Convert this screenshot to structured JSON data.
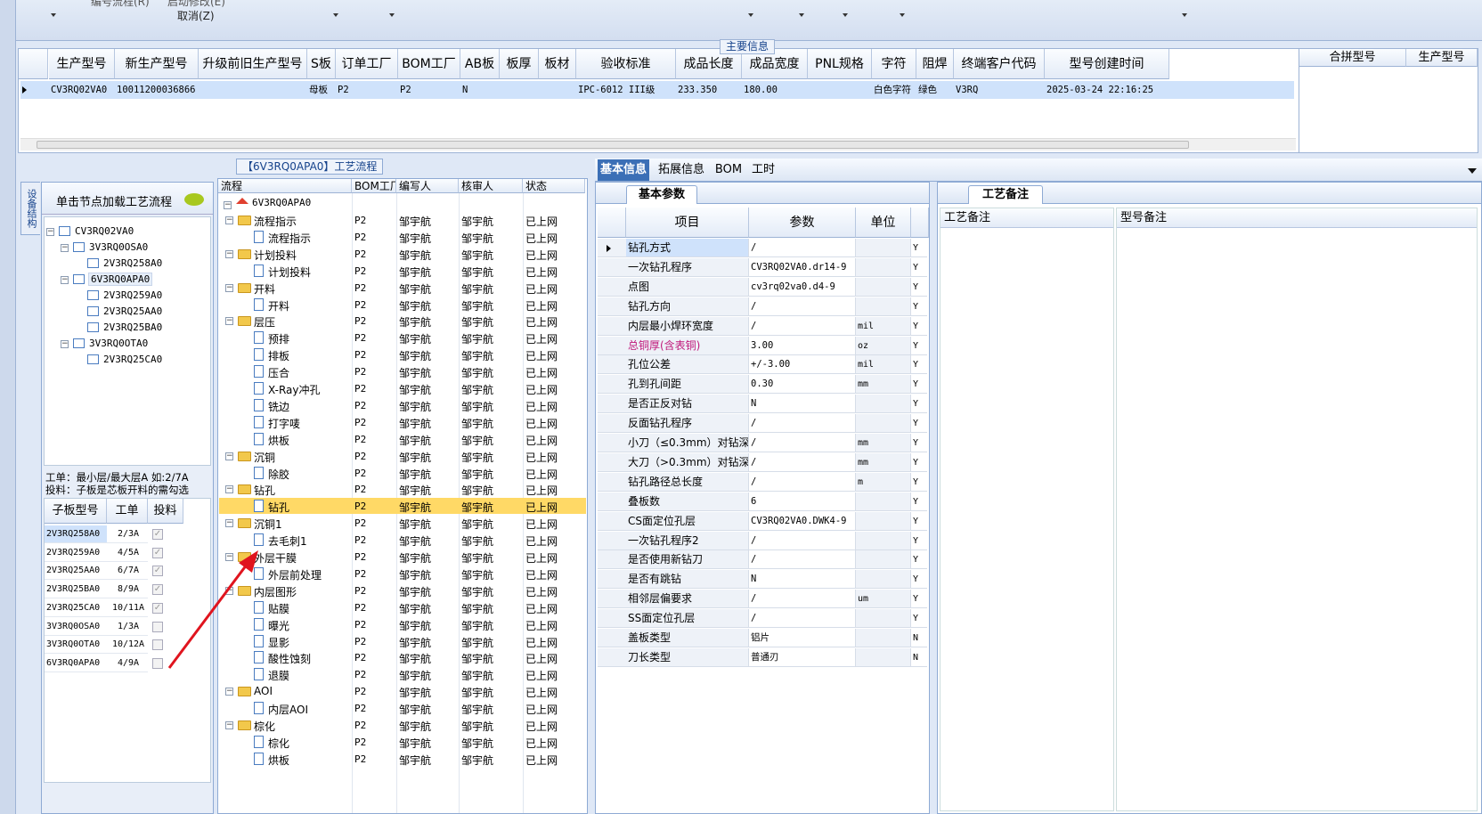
{
  "toolbar": {
    "item1": "编号流程(R)",
    "item2": "启动修改(E)",
    "cancel": "取消(Z)"
  },
  "main_info": {
    "caption": "主要信息",
    "columns": [
      "生产型号",
      "新生产型号",
      "升级前旧生产型号",
      "S板",
      "订单工厂",
      "BOM工厂",
      "AB板",
      "板厚",
      "板材",
      "验收标准",
      "成品长度",
      "成品宽度",
      "PNL规格",
      "字符",
      "阻焊",
      "终端客户代码",
      "型号创建时间"
    ],
    "row": [
      "CV3RQ02VA0",
      "10011200036866",
      "",
      "母板",
      "P2",
      "P2",
      "N",
      "",
      "",
      "IPC-6012 III级",
      "233.350",
      "180.00",
      "",
      "白色字符",
      "绿色",
      "V3RQ",
      "2025-03-24 22:16:25"
    ],
    "side_columns": [
      "合拼型号",
      "生产型号"
    ]
  },
  "process_panel": {
    "caption": "【6V3RQ0APA0】工艺流程",
    "columns": [
      "流程",
      "BOM工厂",
      "编写人",
      "核审人",
      "状态"
    ],
    "root": "6V3RQ0APA0",
    "rows": [
      {
        "level": 1,
        "name": "流程指示",
        "folder": true,
        "bom": "P2",
        "writer": "邹宇航",
        "reviewer": "邹宇航",
        "status": "已上网"
      },
      {
        "level": 2,
        "name": "流程指示",
        "folder": false,
        "bom": "P2",
        "writer": "邹宇航",
        "reviewer": "邹宇航",
        "status": "已上网"
      },
      {
        "level": 1,
        "name": "计划投料",
        "folder": true,
        "bom": "P2",
        "writer": "邹宇航",
        "reviewer": "邹宇航",
        "status": "已上网"
      },
      {
        "level": 2,
        "name": "计划投料",
        "folder": false,
        "bom": "P2",
        "writer": "邹宇航",
        "reviewer": "邹宇航",
        "status": "已上网"
      },
      {
        "level": 1,
        "name": "开料",
        "folder": true,
        "bom": "P2",
        "writer": "邹宇航",
        "reviewer": "邹宇航",
        "status": "已上网"
      },
      {
        "level": 2,
        "name": "开料",
        "folder": false,
        "bom": "P2",
        "writer": "邹宇航",
        "reviewer": "邹宇航",
        "status": "已上网"
      },
      {
        "level": 1,
        "name": "层压",
        "folder": true,
        "bom": "P2",
        "writer": "邹宇航",
        "reviewer": "邹宇航",
        "status": "已上网"
      },
      {
        "level": 2,
        "name": "预排",
        "folder": false,
        "bom": "P2",
        "writer": "邹宇航",
        "reviewer": "邹宇航",
        "status": "已上网"
      },
      {
        "level": 2,
        "name": "排板",
        "folder": false,
        "bom": "P2",
        "writer": "邹宇航",
        "reviewer": "邹宇航",
        "status": "已上网"
      },
      {
        "level": 2,
        "name": "压合",
        "folder": false,
        "bom": "P2",
        "writer": "邹宇航",
        "reviewer": "邹宇航",
        "status": "已上网"
      },
      {
        "level": 2,
        "name": "X-Ray冲孔",
        "folder": false,
        "bom": "P2",
        "writer": "邹宇航",
        "reviewer": "邹宇航",
        "status": "已上网"
      },
      {
        "level": 2,
        "name": "铣边",
        "folder": false,
        "bom": "P2",
        "writer": "邹宇航",
        "reviewer": "邹宇航",
        "status": "已上网"
      },
      {
        "level": 2,
        "name": "打字唛",
        "folder": false,
        "bom": "P2",
        "writer": "邹宇航",
        "reviewer": "邹宇航",
        "status": "已上网"
      },
      {
        "level": 2,
        "name": "烘板",
        "folder": false,
        "bom": "P2",
        "writer": "邹宇航",
        "reviewer": "邹宇航",
        "status": "已上网"
      },
      {
        "level": 1,
        "name": "沉铜",
        "folder": true,
        "bom": "P2",
        "writer": "邹宇航",
        "reviewer": "邹宇航",
        "status": "已上网"
      },
      {
        "level": 2,
        "name": "除胶",
        "folder": false,
        "bom": "P2",
        "writer": "邹宇航",
        "reviewer": "邹宇航",
        "status": "已上网"
      },
      {
        "level": 1,
        "name": "钻孔",
        "folder": true,
        "bom": "P2",
        "writer": "邹宇航",
        "reviewer": "邹宇航",
        "status": "已上网"
      },
      {
        "level": 2,
        "name": "钻孔",
        "folder": false,
        "bom": "P2",
        "writer": "邹宇航",
        "reviewer": "邹宇航",
        "status": "已上网",
        "selected": true
      },
      {
        "level": 1,
        "name": "沉铜1",
        "folder": true,
        "bom": "P2",
        "writer": "邹宇航",
        "reviewer": "邹宇航",
        "status": "已上网"
      },
      {
        "level": 2,
        "name": "去毛刺1",
        "folder": false,
        "bom": "P2",
        "writer": "邹宇航",
        "reviewer": "邹宇航",
        "status": "已上网"
      },
      {
        "level": 1,
        "name": "外层干膜",
        "folder": true,
        "bom": "P2",
        "writer": "邹宇航",
        "reviewer": "邹宇航",
        "status": "已上网"
      },
      {
        "level": 2,
        "name": "外层前处理",
        "folder": false,
        "bom": "P2",
        "writer": "邹宇航",
        "reviewer": "邹宇航",
        "status": "已上网"
      },
      {
        "level": 1,
        "name": "内层图形",
        "folder": true,
        "bom": "P2",
        "writer": "邹宇航",
        "reviewer": "邹宇航",
        "status": "已上网"
      },
      {
        "level": 2,
        "name": "贴膜",
        "folder": false,
        "bom": "P2",
        "writer": "邹宇航",
        "reviewer": "邹宇航",
        "status": "已上网"
      },
      {
        "level": 2,
        "name": "曝光",
        "folder": false,
        "bom": "P2",
        "writer": "邹宇航",
        "reviewer": "邹宇航",
        "status": "已上网"
      },
      {
        "level": 2,
        "name": "显影",
        "folder": false,
        "bom": "P2",
        "writer": "邹宇航",
        "reviewer": "邹宇航",
        "status": "已上网"
      },
      {
        "level": 2,
        "name": "酸性蚀刻",
        "folder": false,
        "bom": "P2",
        "writer": "邹宇航",
        "reviewer": "邹宇航",
        "status": "已上网"
      },
      {
        "level": 2,
        "name": "退膜",
        "folder": false,
        "bom": "P2",
        "writer": "邹宇航",
        "reviewer": "邹宇航",
        "status": "已上网"
      },
      {
        "level": 1,
        "name": "AOI",
        "folder": true,
        "bom": "P2",
        "writer": "邹宇航",
        "reviewer": "邹宇航",
        "status": "已上网"
      },
      {
        "level": 2,
        "name": "内层AOI",
        "folder": false,
        "bom": "P2",
        "writer": "邹宇航",
        "reviewer": "邹宇航",
        "status": "已上网"
      },
      {
        "level": 1,
        "name": "棕化",
        "folder": true,
        "bom": "P2",
        "writer": "邹宇航",
        "reviewer": "邹宇航",
        "status": "已上网"
      },
      {
        "level": 2,
        "name": "棕化",
        "folder": false,
        "bom": "P2",
        "writer": "邹宇航",
        "reviewer": "邹宇航",
        "status": "已上网"
      },
      {
        "level": 2,
        "name": "烘板",
        "folder": false,
        "bom": "P2",
        "writer": "邹宇航",
        "reviewer": "邹宇航",
        "status": "已上网"
      }
    ]
  },
  "left_panel": {
    "side_tab": "设备结构",
    "hint": "单击节点加载工艺流程",
    "tree": [
      {
        "level": 0,
        "name": "CV3RQ02VA0"
      },
      {
        "level": 1,
        "name": "3V3RQ0OSA0"
      },
      {
        "level": 2,
        "name": "2V3RQ258A0"
      },
      {
        "level": 1,
        "name": "6V3RQ0APA0",
        "selected": true
      },
      {
        "level": 2,
        "name": "2V3RQ259A0"
      },
      {
        "level": 2,
        "name": "2V3RQ25AA0"
      },
      {
        "level": 2,
        "name": "2V3RQ25BA0"
      },
      {
        "level": 1,
        "name": "3V3RQ0OTA0"
      },
      {
        "level": 2,
        "name": "2V3RQ25CA0"
      }
    ],
    "note1": "工单：最小层/最大层A 如:2/7A",
    "note2": "投料：子板是芯板开料的需勾选",
    "sub_columns": [
      "子板型号",
      "工单",
      "投料"
    ],
    "sub_rows": [
      {
        "model": "2V3RQ258A0",
        "order": "2/3A",
        "feed": true
      },
      {
        "model": "2V3RQ259A0",
        "order": "4/5A",
        "feed": true
      },
      {
        "model": "2V3RQ25AA0",
        "order": "6/7A",
        "feed": true
      },
      {
        "model": "2V3RQ25BA0",
        "order": "8/9A",
        "feed": true
      },
      {
        "model": "2V3RQ25CA0",
        "order": "10/11A",
        "feed": true
      },
      {
        "model": "3V3RQ0OSA0",
        "order": "1/3A",
        "feed": false
      },
      {
        "model": "3V3RQ0OTA0",
        "order": "10/12A",
        "feed": false
      },
      {
        "model": "6V3RQ0APA0",
        "order": "4/9A",
        "feed": false
      }
    ]
  },
  "right_panel": {
    "tabs": [
      "基本信息",
      "拓展信息",
      "BOM",
      "工时"
    ],
    "subtab": "基本参数",
    "columns": [
      "项目",
      "参数",
      "单位"
    ],
    "params": [
      {
        "item": "钻孔方式",
        "value": "/",
        "unit": "",
        "flag": "Y",
        "selected": true
      },
      {
        "item": "一次钻孔程序",
        "value": "CV3RQ02VA0.dr14-9",
        "unit": "",
        "flag": "Y"
      },
      {
        "item": "点图",
        "value": "cv3rq02va0.d4-9",
        "unit": "",
        "flag": "Y"
      },
      {
        "item": "钻孔方向",
        "value": "/",
        "unit": "",
        "flag": "Y"
      },
      {
        "item": "内层最小焊环宽度",
        "value": "/",
        "unit": "mil",
        "flag": "Y"
      },
      {
        "item": "总铜厚(含表铜)",
        "value": "3.00",
        "unit": "oz",
        "flag": "Y",
        "highlight": true
      },
      {
        "item": "孔位公差",
        "value": "+/-3.00",
        "unit": "mil",
        "flag": "Y"
      },
      {
        "item": "孔到孔间距",
        "value": "0.30",
        "unit": "mm",
        "flag": "Y"
      },
      {
        "item": "是否正反对钻",
        "value": "N",
        "unit": "",
        "flag": "Y"
      },
      {
        "item": "反面钻孔程序",
        "value": "/",
        "unit": "",
        "flag": "Y"
      },
      {
        "item": "小刀（≤0.3mm）对钻深度",
        "value": "/",
        "unit": "mm",
        "flag": "Y"
      },
      {
        "item": "大刀（>0.3mm）对钻深度",
        "value": "/",
        "unit": "mm",
        "flag": "Y"
      },
      {
        "item": "钻孔路径总长度",
        "value": "/",
        "unit": "m",
        "flag": "Y"
      },
      {
        "item": "叠板数",
        "value": "6",
        "unit": "",
        "flag": "Y"
      },
      {
        "item": "CS面定位孔层",
        "value": "CV3RQ02VA0.DWK4-9",
        "unit": "",
        "flag": "Y"
      },
      {
        "item": "一次钻孔程序2",
        "value": "/",
        "unit": "",
        "flag": "Y"
      },
      {
        "item": "是否使用新钻刀",
        "value": "/",
        "unit": "",
        "flag": "Y"
      },
      {
        "item": "是否有跳钻",
        "value": "N",
        "unit": "",
        "flag": "Y"
      },
      {
        "item": "相邻层偏要求",
        "value": "/",
        "unit": "um",
        "flag": "Y"
      },
      {
        "item": "SS面定位孔层",
        "value": "/",
        "unit": "",
        "flag": "Y"
      },
      {
        "item": "盖板类型",
        "value": "铝片",
        "unit": "",
        "flag": "N"
      },
      {
        "item": "刀长类型",
        "value": "普通刃",
        "unit": "",
        "flag": "N"
      }
    ],
    "notes_tab": "工艺备注",
    "notes_columns": [
      "工艺备注",
      "型号备注"
    ]
  },
  "colors": {
    "accent": "#3b6fb6",
    "selected_row": "#ffd966",
    "annotation_arrow": "#e0141e",
    "highlight_text": "#c0187a"
  }
}
